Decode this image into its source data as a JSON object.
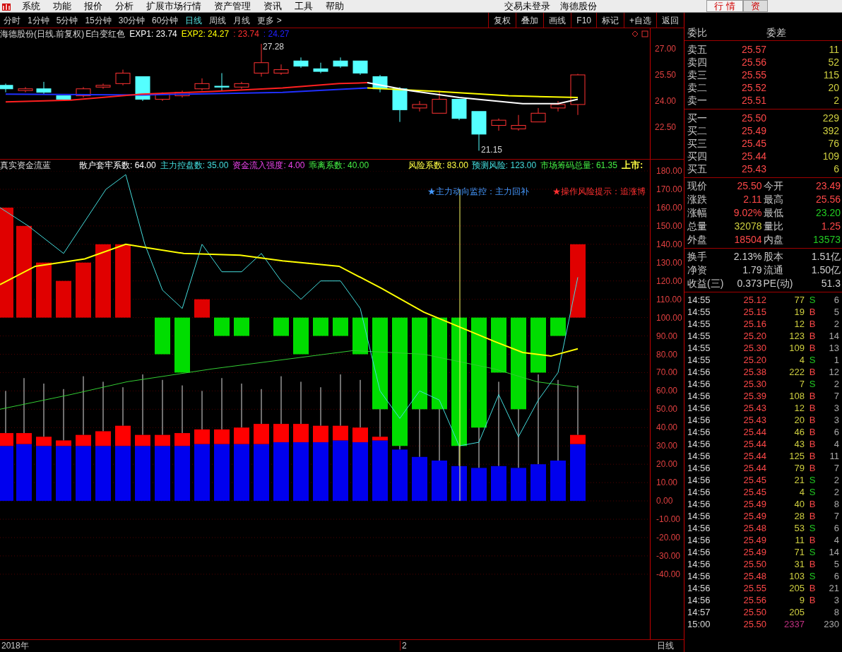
{
  "menu_bar": {
    "items": [
      "系统",
      "功能",
      "报价",
      "分析",
      "扩展市场行情",
      "资产管理",
      "资讯",
      "工具",
      "帮助"
    ],
    "status": "交易未登录",
    "stock": "海德股份",
    "tabs": [
      {
        "label": "行 情",
        "selected": true
      },
      {
        "label": "资",
        "selected": false
      }
    ]
  },
  "period_bar": {
    "items": [
      {
        "label": "分时",
        "selected": false
      },
      {
        "label": "1分钟",
        "selected": false
      },
      {
        "label": "5分钟",
        "selected": false
      },
      {
        "label": "15分钟",
        "selected": false
      },
      {
        "label": "30分钟",
        "selected": false
      },
      {
        "label": "60分钟",
        "selected": false
      },
      {
        "label": "日线",
        "selected": true
      },
      {
        "label": "周线",
        "selected": false
      },
      {
        "label": "月线",
        "selected": false
      },
      {
        "label": "更多 >",
        "selected": false
      }
    ]
  },
  "toolbar": [
    "复权",
    "叠加",
    "画线",
    "F10",
    "标记",
    "+自选",
    "返回"
  ],
  "price_chart": {
    "title": "海德股份(日线.前复权)",
    "formula": "E白变红色",
    "legend": [
      {
        "label": "EXP1: 23.74",
        "color": "#ffffff"
      },
      {
        "label": "EXP2: 24.27",
        "color": "#ffff00"
      },
      {
        "label": ": 23.74",
        "color": "#ff3030"
      },
      {
        "label": ": 24.27",
        "color": "#2020ff"
      }
    ],
    "high_label": "27.28",
    "low_label": "21.15",
    "y_ticks": [
      "27.00",
      "25.50",
      "24.00",
      "22.50"
    ]
  },
  "indicator_chart": {
    "title": "真实资金流蓝",
    "metrics": [
      {
        "label": "散户套牢系数: 64.00",
        "color": "#ffffff"
      },
      {
        "label": "主力控盘数: 35.00",
        "color": "#44dddd"
      },
      {
        "label": "资金流入强度: 4.00",
        "color": "#ee44ee"
      },
      {
        "label": "乖离系数: 40.00",
        "color": "#44ee44"
      },
      {
        "label": "风险系数: 83.00",
        "color": "#ffff44"
      },
      {
        "label": "预测风险: 123.00",
        "color": "#44dddd"
      },
      {
        "label": "市场筹码总量: 61.35",
        "color": "#44ee44"
      },
      {
        "label": "上市:",
        "color": "#ffff44"
      }
    ],
    "signals": [
      {
        "label": "★主力动向监控：主力回补",
        "color": "#4499ff"
      },
      {
        "label": "★操作风险提示：追涨博",
        "color": "#ff3030"
      }
    ],
    "y_ticks": [
      "180.00",
      "170.00",
      "160.00",
      "150.00",
      "140.00",
      "130.00",
      "120.00",
      "110.00",
      "100.00",
      "90.00",
      "80.00",
      "70.00",
      "60.00",
      "50.00",
      "40.00",
      "30.00",
      "20.00",
      "10.00",
      "0.00",
      "-10.00",
      "-20.00",
      "-30.00",
      "-40.00"
    ]
  },
  "quote_panel": {
    "ratio_labels": [
      "委比",
      "委差"
    ],
    "asks": [
      {
        "label": "卖五",
        "price": "25.57",
        "volume": "11"
      },
      {
        "label": "卖四",
        "price": "25.56",
        "volume": "52"
      },
      {
        "label": "卖三",
        "price": "25.55",
        "volume": "115"
      },
      {
        "label": "卖二",
        "price": "25.52",
        "volume": "20"
      },
      {
        "label": "卖一",
        "price": "25.51",
        "volume": "2"
      }
    ],
    "bids": [
      {
        "label": "买一",
        "price": "25.50",
        "volume": "229"
      },
      {
        "label": "买二",
        "price": "25.49",
        "volume": "392"
      },
      {
        "label": "买三",
        "price": "25.45",
        "volume": "76"
      },
      {
        "label": "买四",
        "price": "25.44",
        "volume": "109"
      },
      {
        "label": "买五",
        "price": "25.43",
        "volume": "6"
      }
    ],
    "stats": [
      {
        "label": "现价",
        "value": "25.50",
        "color": "#ff4848"
      },
      {
        "label": "今开",
        "value": "23.49",
        "color": "#ff4848"
      },
      {
        "label": "涨跌",
        "value": "2.11",
        "color": "#ff4848"
      },
      {
        "label": "最高",
        "value": "25.56",
        "color": "#ff4848"
      },
      {
        "label": "涨幅",
        "value": "9.02%",
        "color": "#ff4848"
      },
      {
        "label": "最低",
        "value": "23.20",
        "color": "#22cc22"
      },
      {
        "label": "总量",
        "value": "32078",
        "color": "#d0d040"
      },
      {
        "label": "量比",
        "value": "1.25",
        "color": "#ff4848"
      },
      {
        "label": "外盘",
        "value": "18504",
        "color": "#ff4848"
      },
      {
        "label": "内盘",
        "value": "13573",
        "color": "#22cc22"
      }
    ],
    "finance": [
      {
        "label": "换手",
        "value": "2.13%"
      },
      {
        "label": "股本",
        "value": "1.51亿"
      },
      {
        "label": "净资",
        "value": "1.79"
      },
      {
        "label": "流通",
        "value": "1.50亿"
      },
      {
        "label": "收益(三)",
        "value": "0.373"
      },
      {
        "label": "PE(动)",
        "value": "51.3"
      }
    ]
  },
  "trades": [
    {
      "time": "14:55",
      "price": "25.12",
      "volume": "77",
      "side": "S",
      "count": "6",
      "kind": "trade"
    },
    {
      "time": "14:55",
      "price": "25.15",
      "volume": "19",
      "side": "B",
      "count": "5",
      "kind": "trade"
    },
    {
      "time": "14:55",
      "price": "25.16",
      "volume": "12",
      "side": "B",
      "count": "2",
      "kind": "trade"
    },
    {
      "time": "14:55",
      "price": "25.20",
      "volume": "123",
      "side": "B",
      "count": "14",
      "kind": "trade"
    },
    {
      "time": "14:55",
      "price": "25.30",
      "volume": "109",
      "side": "B",
      "count": "13",
      "kind": "trade"
    },
    {
      "time": "14:55",
      "price": "25.20",
      "volume": "4",
      "side": "S",
      "count": "1",
      "kind": "trade"
    },
    {
      "time": "14:56",
      "price": "25.38",
      "volume": "222",
      "side": "B",
      "count": "12",
      "kind": "trade"
    },
    {
      "time": "14:56",
      "price": "25.30",
      "volume": "7",
      "side": "S",
      "count": "2",
      "kind": "trade"
    },
    {
      "time": "14:56",
      "price": "25.39",
      "volume": "108",
      "side": "B",
      "count": "7",
      "kind": "trade"
    },
    {
      "time": "14:56",
      "price": "25.43",
      "volume": "12",
      "side": "B",
      "count": "3",
      "kind": "trade"
    },
    {
      "time": "14:56",
      "price": "25.43",
      "volume": "20",
      "side": "B",
      "count": "3",
      "kind": "trade"
    },
    {
      "time": "14:56",
      "price": "25.44",
      "volume": "46",
      "side": "B",
      "count": "6",
      "kind": "trade"
    },
    {
      "time": "14:56",
      "price": "25.44",
      "volume": "43",
      "side": "B",
      "count": "4",
      "kind": "trade"
    },
    {
      "time": "14:56",
      "price": "25.44",
      "volume": "125",
      "side": "B",
      "count": "11",
      "kind": "trade"
    },
    {
      "time": "14:56",
      "price": "25.44",
      "volume": "79",
      "side": "B",
      "count": "7",
      "kind": "trade"
    },
    {
      "time": "14:56",
      "price": "25.45",
      "volume": "21",
      "side": "S",
      "count": "2",
      "kind": "trade"
    },
    {
      "time": "14:56",
      "price": "25.45",
      "volume": "4",
      "side": "S",
      "count": "2",
      "kind": "trade"
    },
    {
      "time": "14:56",
      "price": "25.49",
      "volume": "40",
      "side": "B",
      "count": "8",
      "kind": "trade"
    },
    {
      "time": "14:56",
      "price": "25.49",
      "volume": "28",
      "side": "B",
      "count": "7",
      "kind": "trade"
    },
    {
      "time": "14:56",
      "price": "25.48",
      "volume": "53",
      "side": "S",
      "count": "6",
      "kind": "trade"
    },
    {
      "time": "14:56",
      "price": "25.49",
      "volume": "11",
      "side": "B",
      "count": "4",
      "kind": "trade"
    },
    {
      "time": "14:56",
      "price": "25.49",
      "volume": "71",
      "side": "S",
      "count": "14",
      "kind": "trade"
    },
    {
      "time": "14:56",
      "price": "25.50",
      "volume": "31",
      "side": "B",
      "count": "5",
      "kind": "trade"
    },
    {
      "time": "14:56",
      "price": "25.48",
      "volume": "103",
      "side": "S",
      "count": "6",
      "kind": "trade"
    },
    {
      "time": "14:56",
      "price": "25.55",
      "volume": "205",
      "side": "B",
      "count": "21",
      "kind": "trade"
    },
    {
      "time": "14:56",
      "price": "25.56",
      "volume": "9",
      "side": "B",
      "count": "3",
      "kind": "trade"
    },
    {
      "time": "14:57",
      "price": "25.50",
      "volume": "205",
      "count": "8",
      "kind": "trade"
    },
    {
      "time": "15:00",
      "price": "25.50",
      "volume": "2337",
      "count": "230",
      "kind": "close"
    }
  ],
  "bottom_bar": {
    "year": "2018年",
    "month": "2",
    "period": "日线"
  }
}
